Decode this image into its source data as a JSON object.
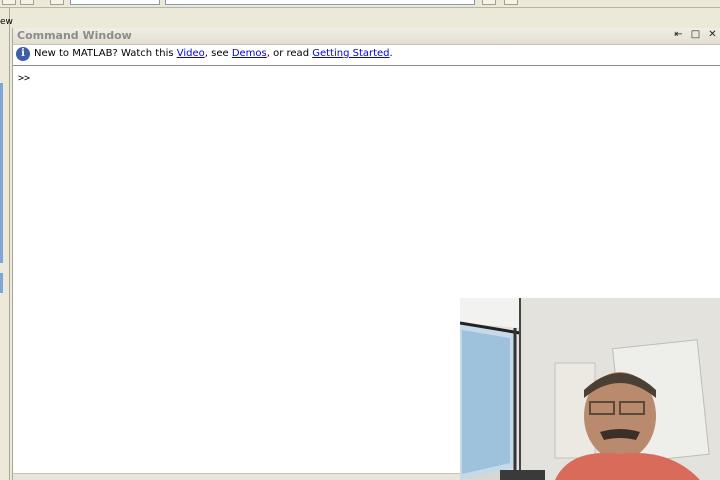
{
  "left_panel": {
    "label": "ew"
  },
  "command_window": {
    "title": "Command Window",
    "controls": {
      "undock": "⇤",
      "maximize": "□",
      "close": "✕"
    }
  },
  "info_bar": {
    "icon": "info-icon",
    "text_before": "New to MATLAB? Watch this ",
    "video_link": "Video",
    "text_mid1": ", see ",
    "demos_link": "Demos",
    "text_mid2": ", or read ",
    "getting_started_link": "Getting Started",
    "text_end": "."
  },
  "prompt": ">>",
  "colors": {
    "link": "#0000ee",
    "title_text": "#8c8c8c",
    "info_icon": "#3a5fa8"
  }
}
